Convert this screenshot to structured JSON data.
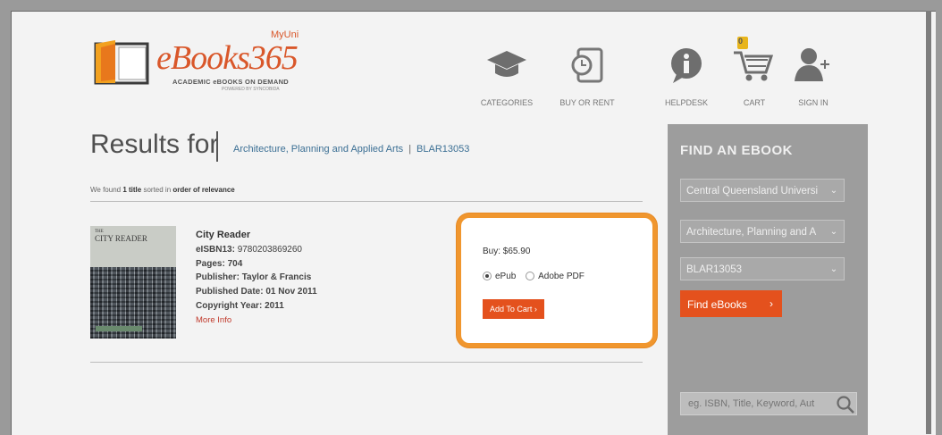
{
  "brand": {
    "name": "eBooks365",
    "badge": "MyUni",
    "tagline": "ACADEMIC eBOOKS ON DEMAND",
    "powered_by": "POWERED BY SYNCOBIDA",
    "accent": "#d9572a"
  },
  "nav": [
    {
      "label": "CATEGORIES",
      "icon": "graduation-cap-icon"
    },
    {
      "label": "BUY OR RENT",
      "icon": "tablet-clock-icon"
    },
    {
      "label": "HELPDESK",
      "icon": "info-icon"
    },
    {
      "label": "CART",
      "icon": "cart-icon",
      "badge": "0"
    },
    {
      "label": "SIGN IN",
      "icon": "user-add-icon"
    }
  ],
  "results": {
    "heading": "Results for",
    "crumbs": [
      "Architecture, Planning and Applied Arts",
      "BLAR13053"
    ],
    "found_prefix": "We found ",
    "found_count": "1 title",
    "found_mid": " sorted in ",
    "found_order": "order of relevance"
  },
  "book": {
    "cover_small": "THE",
    "cover_title": "CITY READER",
    "title": "City Reader",
    "eisbn_label": "eISBN13:",
    "eisbn": "9780203869260",
    "pages_label": "Pages:",
    "pages": "704",
    "publisher_label": "Publisher:",
    "publisher": "Taylor & Francis",
    "published_label": "Published Date:",
    "published": "01 Nov 2011",
    "copyright_label": "Copyright Year:",
    "copyright": "2011",
    "more_info": "More Info"
  },
  "purchase": {
    "price": "Buy: $65.90",
    "formats": [
      "ePub",
      "Adobe PDF"
    ],
    "selected_format": "ePub",
    "add_to_cart": "Add To Cart",
    "add_to_cart_arrow": "›",
    "highlight_color": "#f0962e",
    "button_color": "#e4511d"
  },
  "sidebar": {
    "title": "FIND AN EBOOK",
    "institution": "Central Queensland Universi",
    "category": "Architecture, Planning and A",
    "course": "BLAR13053",
    "find_button": "Find eBooks",
    "find_arrow": "›",
    "search_placeholder": "eg. ISBN, Title, Keyword, Aut"
  }
}
